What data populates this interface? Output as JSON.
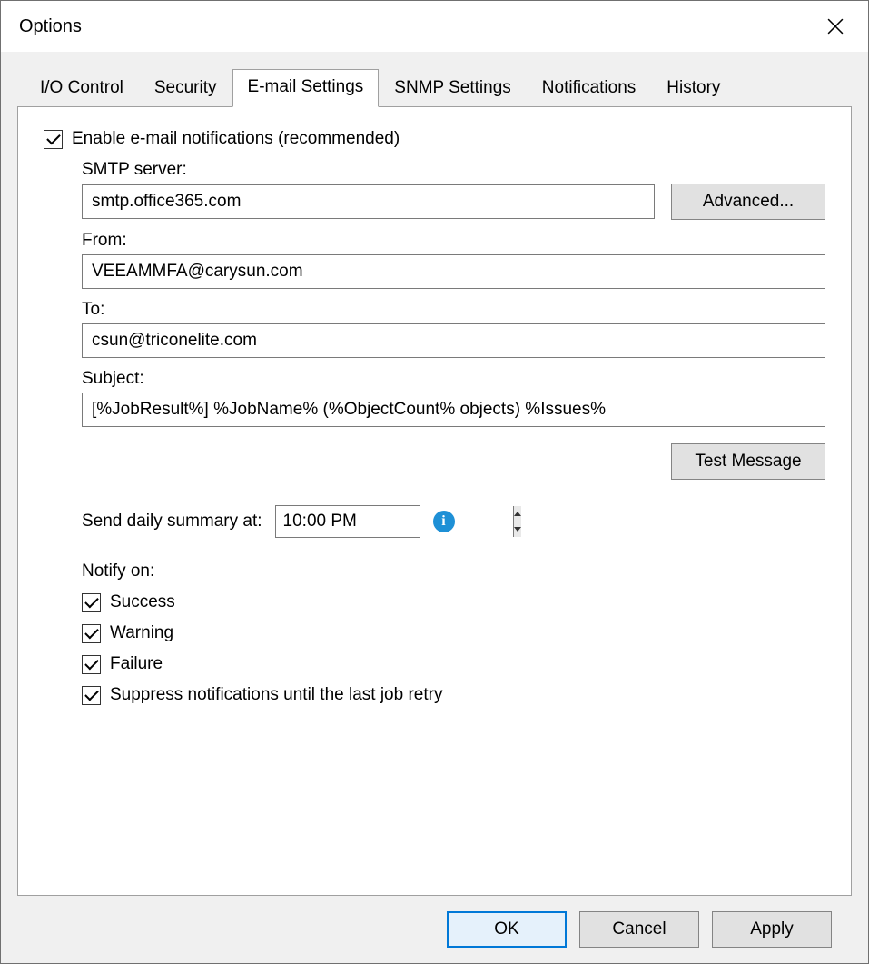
{
  "window": {
    "title": "Options"
  },
  "tabs": [
    {
      "label": "I/O Control"
    },
    {
      "label": "Security"
    },
    {
      "label": "E-mail Settings"
    },
    {
      "label": "SNMP Settings"
    },
    {
      "label": "Notifications"
    },
    {
      "label": "History"
    }
  ],
  "email": {
    "enable_label": "Enable e-mail notifications (recommended)",
    "enable_checked": true,
    "smtp_label": "SMTP server:",
    "smtp_value": "smtp.office365.com",
    "advanced_button": "Advanced...",
    "from_label": "From:",
    "from_value": "VEEAMMFA@carysun.com",
    "to_label": "To:",
    "to_value": "csun@triconelite.com",
    "subject_label": "Subject:",
    "subject_value": "[%JobResult%] %JobName% (%ObjectCount% objects) %Issues%",
    "test_button": "Test Message",
    "summary_label": "Send daily summary at:",
    "summary_time": "10:00 PM",
    "notify_label": "Notify on:",
    "notify_success": "Success",
    "notify_warning": "Warning",
    "notify_failure": "Failure",
    "notify_suppress": "Suppress notifications until the last job retry"
  },
  "footer": {
    "ok": "OK",
    "cancel": "Cancel",
    "apply": "Apply"
  }
}
